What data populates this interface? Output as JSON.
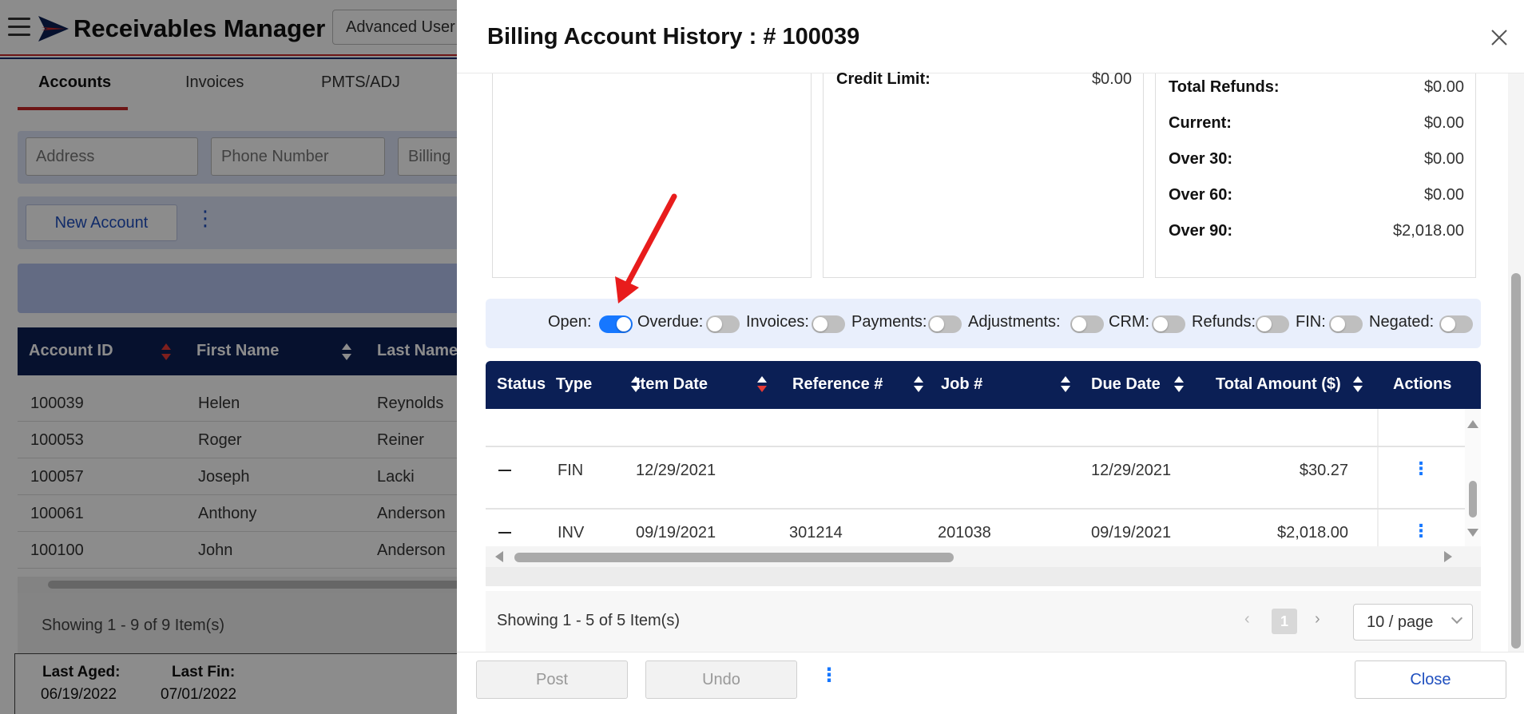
{
  "app": {
    "title": "Receivables Manager",
    "user_select": "Advanced User",
    "brand_colors": {
      "navy": "#0b1f55",
      "red": "#c62828",
      "accent_blue": "#1677ff"
    }
  },
  "main_tabs": [
    {
      "label": "Accounts",
      "active": true
    },
    {
      "label": "Invoices",
      "active": false
    },
    {
      "label": "PMTS/ADJ",
      "active": false
    }
  ],
  "filters": {
    "address_placeholder": "Address",
    "phone_placeholder": "Phone Number",
    "billing_placeholder": "Billing"
  },
  "toolbar": {
    "new_account_label": "New Account"
  },
  "accounts_table": {
    "columns": [
      "Account ID",
      "First Name",
      "Last Name"
    ],
    "rows": [
      [
        "100039",
        "Helen",
        "Reynolds"
      ],
      [
        "100053",
        "Roger",
        "Reiner"
      ],
      [
        "100057",
        "Joseph",
        "Lacki"
      ],
      [
        "100061",
        "Anthony",
        "Anderson"
      ],
      [
        "100100",
        "John",
        "Anderson"
      ]
    ],
    "showing": "Showing 1 - 9 of 9 Item(s)"
  },
  "aging": {
    "last_aged_label": "Last Aged:",
    "last_aged_value": "06/19/2022",
    "last_fin_label": "Last Fin:",
    "last_fin_value": "07/01/2022"
  },
  "drawer": {
    "title": "Billing Account History : # 100039",
    "credit_limit_label": "Credit Limit:",
    "credit_limit_value": "$0.00",
    "summary": [
      {
        "label": "Total Refunds:",
        "value": "$0.00"
      },
      {
        "label": "Current:",
        "value": "$0.00"
      },
      {
        "label": "Over 30:",
        "value": "$0.00"
      },
      {
        "label": "Over 60:",
        "value": "$0.00"
      },
      {
        "label": "Over 90:",
        "value": "$2,018.00"
      }
    ],
    "toggles": [
      {
        "label": "Open:",
        "on": true
      },
      {
        "label": "Overdue:",
        "on": false
      },
      {
        "label": "Invoices:",
        "on": false
      },
      {
        "label": "Payments:",
        "on": false
      },
      {
        "label": "Adjustments:",
        "on": false
      },
      {
        "label": "CRM:",
        "on": false
      },
      {
        "label": "Refunds:",
        "on": false
      },
      {
        "label": "FIN:",
        "on": false
      },
      {
        "label": "Negated:",
        "on": false
      }
    ],
    "grid": {
      "columns": [
        "Status",
        "Type",
        "Item Date",
        "Reference #",
        "Job #",
        "Due Date",
        "Total Amount ($)",
        "Actions"
      ],
      "rows": [
        {
          "type": "FIN",
          "item_date": "12/29/2021",
          "reference": "",
          "job": "",
          "due_date": "12/29/2021",
          "amount": "$30.27"
        },
        {
          "type": "INV",
          "item_date": "09/19/2021",
          "reference": "301214",
          "job": "201038",
          "due_date": "09/19/2021",
          "amount": "$2,018.00"
        }
      ]
    },
    "pager": {
      "showing": "Showing 1 - 5 of 5 Item(s)",
      "current_page": "1",
      "per_page": "10 / page"
    },
    "footer": {
      "post_label": "Post",
      "undo_label": "Undo",
      "close_label": "Close"
    }
  }
}
